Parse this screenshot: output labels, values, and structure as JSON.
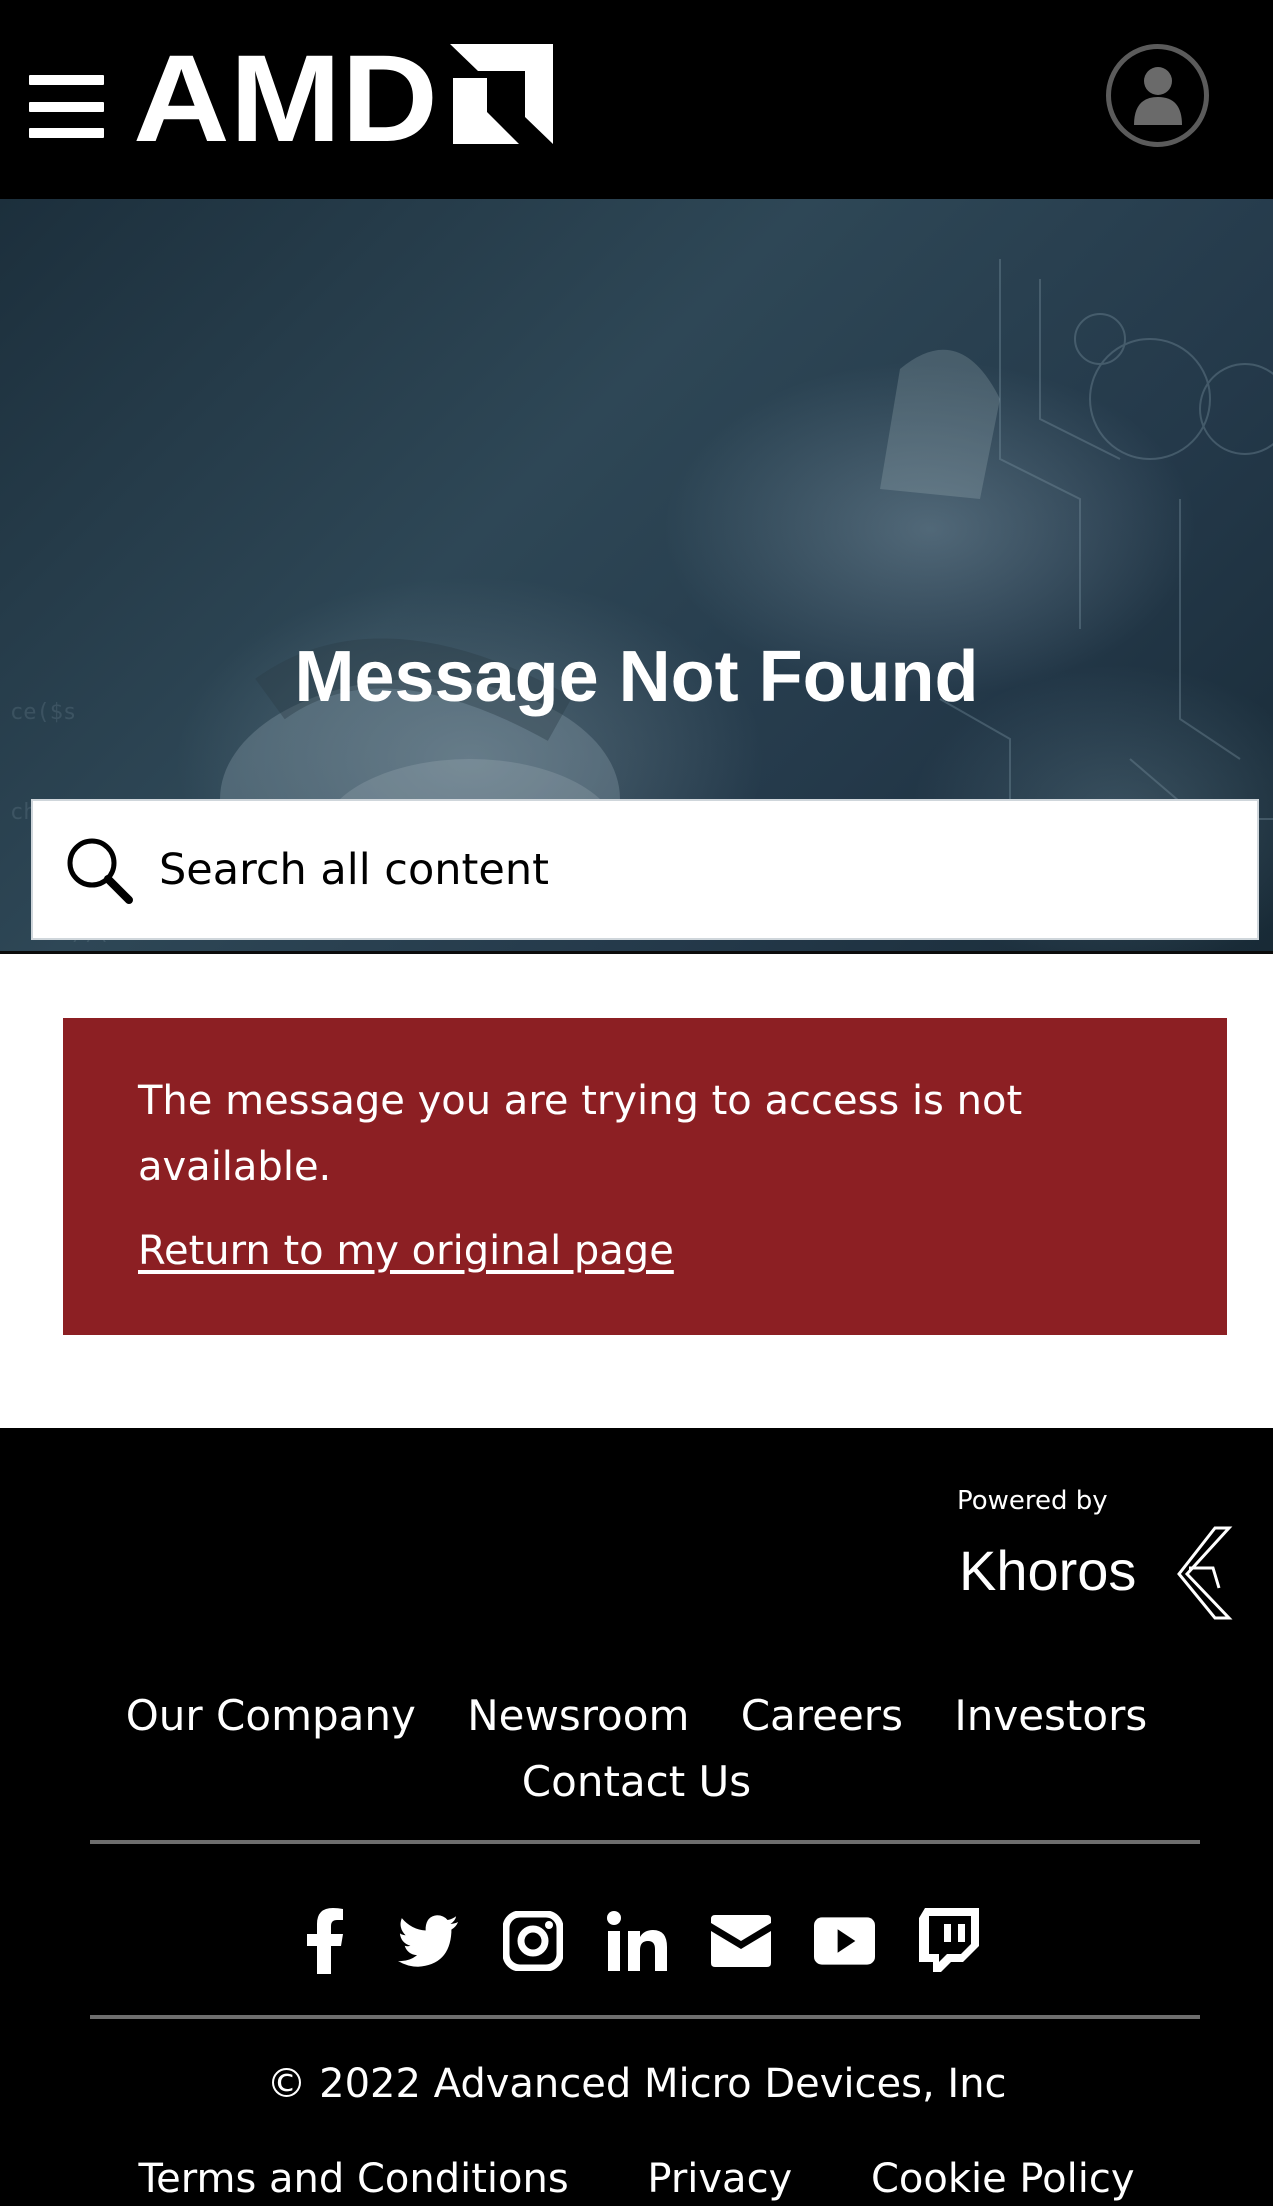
{
  "header": {
    "logo_text": "AMD",
    "menu_icon": "hamburger-menu-icon",
    "avatar_icon": "user-avatar-icon"
  },
  "hero": {
    "title": "Message Not Found",
    "search_placeholder": "Search all content",
    "search_icon": "search-icon"
  },
  "alert": {
    "message": "The message you are trying to access is not available.",
    "link_label": "Return to my original page",
    "background": "#8c1f23"
  },
  "footer": {
    "powered_by": "Powered by",
    "khoros_logo_text": "Khoros",
    "nav": [
      "Our Company",
      "Newsroom",
      "Careers",
      "Investors",
      "Contact Us"
    ],
    "social_icons": [
      "facebook-icon",
      "twitter-icon",
      "instagram-icon",
      "linkedin-icon",
      "email-icon",
      "youtube-icon",
      "twitch-icon"
    ],
    "copyright": "© 2022 Advanced Micro Devices, Inc",
    "legal": [
      "Terms and Conditions",
      "Privacy",
      "Cookie Policy"
    ]
  }
}
